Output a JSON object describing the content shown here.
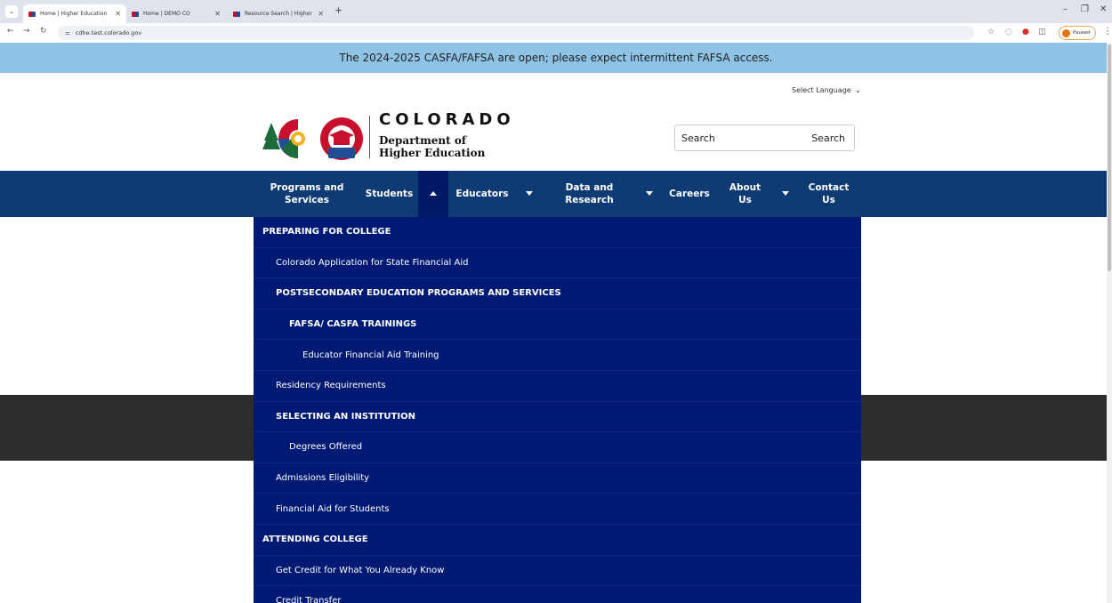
{
  "browser": {
    "tabs": [
      {
        "title": "Home | Higher Education",
        "active": true
      },
      {
        "title": "Home | DEMO CO",
        "active": false
      },
      {
        "title": "Resource Search | Higher Educ",
        "active": false
      }
    ],
    "url": "cdhe.test.colorado.gov",
    "profile_status": "Paused"
  },
  "alert": {
    "text": "The 2024-2025 CASFA/FAFSA are open; please expect intermittent FAFSA access."
  },
  "language": {
    "label": "Select Language"
  },
  "logo": {
    "state": "COLORADO",
    "dept_line1": "Department of",
    "dept_line2": "Higher Education",
    "badge": "CDHE"
  },
  "search": {
    "placeholder": "Search",
    "button": "Search"
  },
  "nav": {
    "items": [
      {
        "label": "Programs and Services"
      },
      {
        "label": "Students"
      },
      {
        "label": "Educators"
      },
      {
        "label": "Data and Research"
      },
      {
        "label": "Careers"
      },
      {
        "label": "About Us"
      },
      {
        "label": "Contact Us"
      }
    ]
  },
  "dropdown": {
    "items": [
      {
        "label": "PREPARING FOR COLLEGE",
        "level": 0
      },
      {
        "label": "Colorado Application for State Financial Aid",
        "level": 1
      },
      {
        "label": "POSTSECONDARY EDUCATION PROGRAMS AND SERVICES",
        "level": 1
      },
      {
        "label": "FAFSA/ CASFA TRAININGS",
        "level": 2
      },
      {
        "label": "Educator Financial Aid Training",
        "level": 3
      },
      {
        "label": "Residency Requirements",
        "level": 1
      },
      {
        "label": "SELECTING AN INSTITUTION",
        "level": 1
      },
      {
        "label": "Degrees Offered",
        "level": 2
      },
      {
        "label": "Admissions Eligibility",
        "level": 1
      },
      {
        "label": "Financial Aid for Students",
        "level": 1
      },
      {
        "label": "ATTENDING COLLEGE",
        "level": 0
      },
      {
        "label": "Get Credit for What You Already Know",
        "level": 1
      },
      {
        "label": "Credit Transfer",
        "level": 1
      }
    ]
  }
}
